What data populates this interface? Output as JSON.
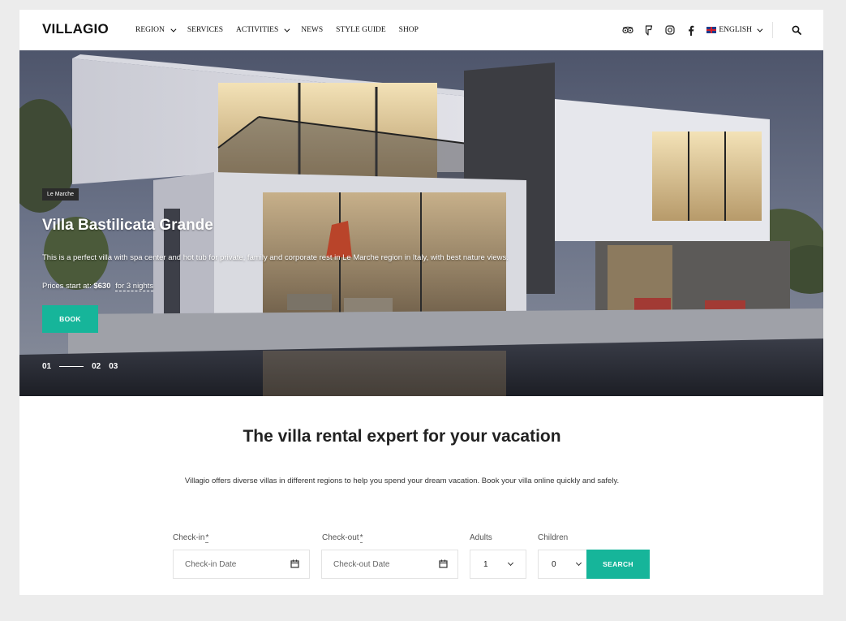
{
  "header": {
    "logo": "VILLAGIO",
    "nav": [
      {
        "label": "REGION",
        "has_dropdown": true
      },
      {
        "label": "SERVICES",
        "has_dropdown": false
      },
      {
        "label": "ACTIVITIES",
        "has_dropdown": true
      },
      {
        "label": "NEWS",
        "has_dropdown": false
      },
      {
        "label": "STYLE GUIDE",
        "has_dropdown": false
      },
      {
        "label": "SHOP",
        "has_dropdown": false
      }
    ],
    "social_icons": [
      "tripadvisor-icon",
      "foursquare-icon",
      "instagram-icon",
      "facebook-icon"
    ],
    "language": "ENGLISH",
    "search_icon": "search-icon"
  },
  "hero": {
    "badge": "Le Marche",
    "title": "Villa Bastilicata Grande",
    "description": "This is a perfect villa with spa center and hot tub for private, family and corporate rest in Le Marche region in Italy, with best nature views.",
    "price_prefix": "Prices start at:",
    "price_value": "$630",
    "price_suffix": "for 3 nights",
    "book_label": "BOOK",
    "slides": [
      "01",
      "02",
      "03"
    ],
    "active_slide": "01"
  },
  "content": {
    "headline": "The villa rental expert for your vacation",
    "intro": "Villagio offers diverse  villas in different regions to help you spend your dream vacation. Book your villa online quickly and safely."
  },
  "booking": {
    "checkin_label": "Check-in",
    "checkin_placeholder": "Check-in Date",
    "checkout_label": "Check-out",
    "checkout_placeholder": "Check-out Date",
    "required_mark": "*",
    "adults_label": "Adults",
    "adults_value": "1",
    "children_label": "Children",
    "children_value": "0",
    "search_label": "SEARCH"
  },
  "colors": {
    "accent": "#16b59a",
    "text": "#222222"
  }
}
